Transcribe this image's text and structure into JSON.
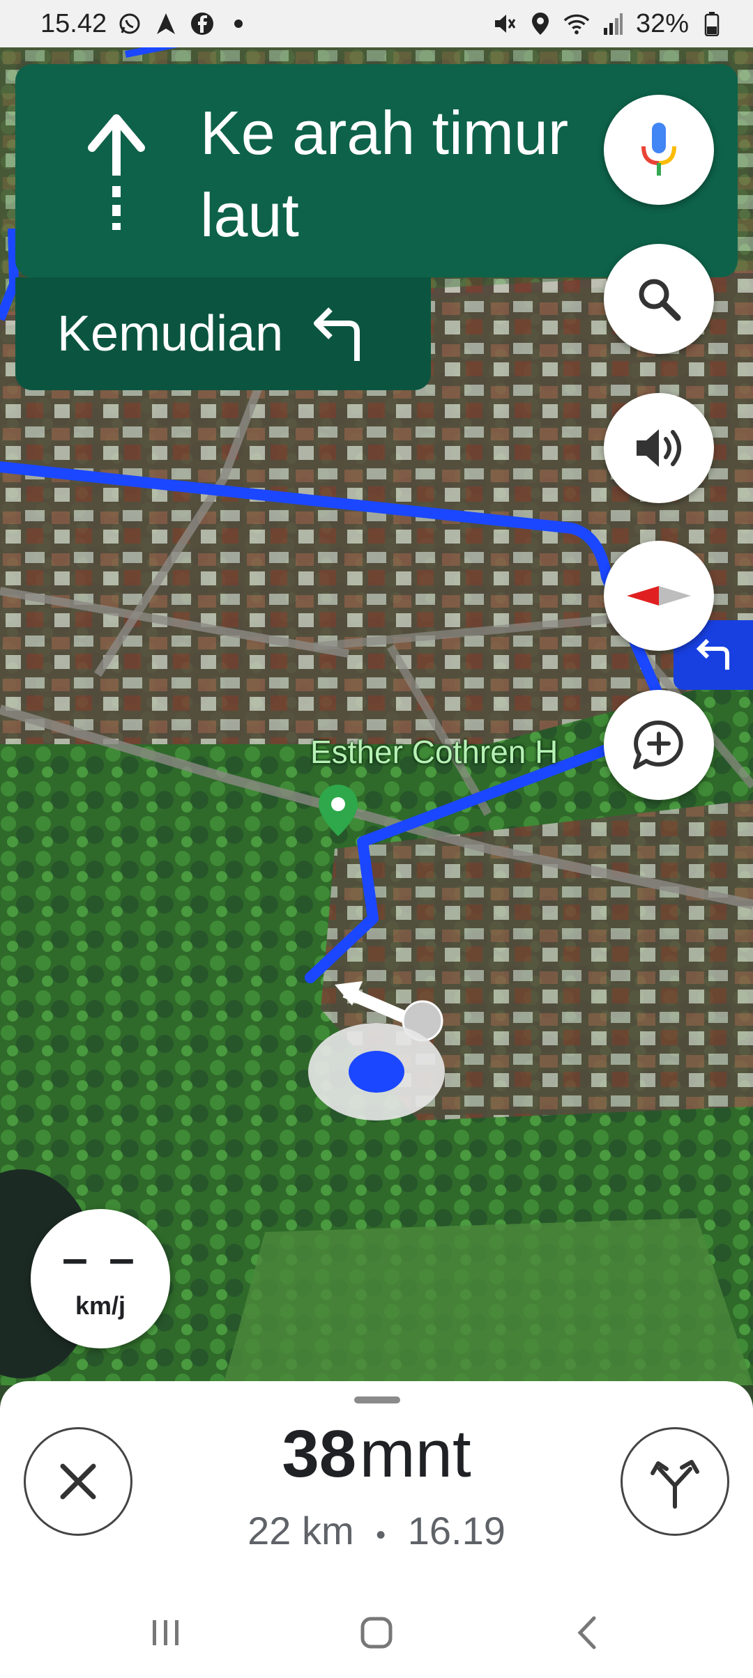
{
  "status_bar": {
    "time": "15.42",
    "battery": "32%",
    "left_icons": [
      "whatsapp-icon",
      "navigation-icon",
      "facebook-icon",
      "dot-icon"
    ],
    "right_icons": [
      "mute-icon",
      "location-icon",
      "wifi-icon",
      "signal-icon",
      "battery-icon"
    ]
  },
  "navigation": {
    "instruction": "Ke arah timur laut",
    "then_label": "Kemudian",
    "primary_icon": "straight-arrow-icon",
    "then_icon": "turn-left-icon"
  },
  "map": {
    "poi_label": "Esther Cothren H",
    "poi_icon": "flower-pin-icon",
    "route_color": "#1a47ff",
    "route_tag_icon": "turn-left-icon"
  },
  "side_buttons": [
    "voice-search-icon",
    "search-icon",
    "sound-icon",
    "compass-icon",
    "add-report-icon"
  ],
  "speedometer": {
    "value": "– –",
    "unit": "km/j"
  },
  "trip": {
    "duration_value": "38",
    "duration_unit": "mnt",
    "distance": "22 km",
    "separator": "•",
    "arrival": "16.19"
  },
  "colors": {
    "banner": "#0e6249",
    "banner_then": "#0b5540",
    "route": "#1a47ff"
  }
}
